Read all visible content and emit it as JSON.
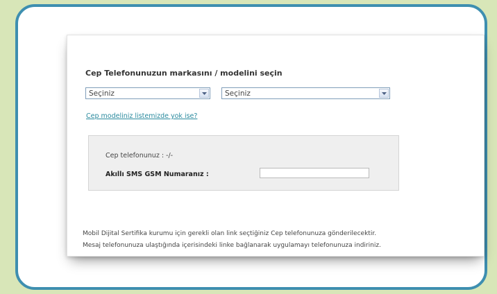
{
  "form": {
    "title": "Cep Telefonunuzun markasını / modelini seçin",
    "brand_select": {
      "value": "Seçiniz"
    },
    "model_select": {
      "value": "Seçiniz"
    },
    "missing_model_link": "Cep modeliniz listemizde yok ise?",
    "phone_label": "Cep telefonunuz : -/-",
    "gsm_label": "Akıllı SMS GSM Numaranız :",
    "gsm_input": {
      "value": ""
    },
    "info_line1": "Mobil Dijital Sertifika kurumu için gerekli olan link seçtiğiniz Cep telefonunuza gönderilecektir.",
    "info_line2": "Mesaj telefonunuza ulaştığında içerisindeki linke bağlanarak uygulamayı telefonunuza indiriniz."
  },
  "icons": {
    "dropdown": "chevron-down-icon"
  },
  "colors": {
    "outer_background": "#d8e6b8",
    "frame_border": "#3e8fb0",
    "link": "#2a8a9e",
    "panel_background": "#efefef"
  }
}
